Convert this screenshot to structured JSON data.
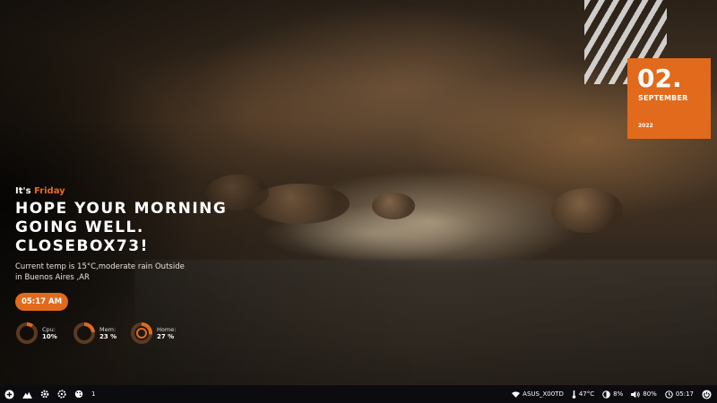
{
  "date_card": {
    "day": "02.",
    "month": "SEPTEMBER",
    "year": "2022"
  },
  "greeting": {
    "prefix": "It's",
    "weekday": "Friday",
    "headline_lines": [
      "HOPE YOUR MORNING",
      "GOING WELL.",
      "CLOSEBOX73!"
    ],
    "weather_line1": "Current temp is 15°C,moderate rain Outside",
    "weather_line2": "in Buenos Aires ,AR"
  },
  "time_pill": "05:17 AM",
  "gauges": [
    {
      "label": "Cpu:",
      "value": "10%",
      "fraction": 0.1
    },
    {
      "label": "Mem:",
      "value": "23 %",
      "fraction": 0.23
    },
    {
      "label": "Home:",
      "value": "27 %",
      "fraction": 0.27
    }
  ],
  "taskbar": {
    "workspace": "1",
    "wifi_name": "ASUS_X00TD",
    "temperature": "47°C",
    "brightness": "8%",
    "volume": "80%",
    "clock": "05:17",
    "icons": [
      "plus-icon",
      "mountain-icon",
      "gear-icon",
      "settings-cog-icon",
      "palette-icon",
      "wifi-icon",
      "thermometer-icon",
      "brightness-icon",
      "volume-icon",
      "clock-icon",
      "power-icon"
    ]
  },
  "colors": {
    "accent": "#e26a1c",
    "taskbar": "#0c0c10"
  }
}
